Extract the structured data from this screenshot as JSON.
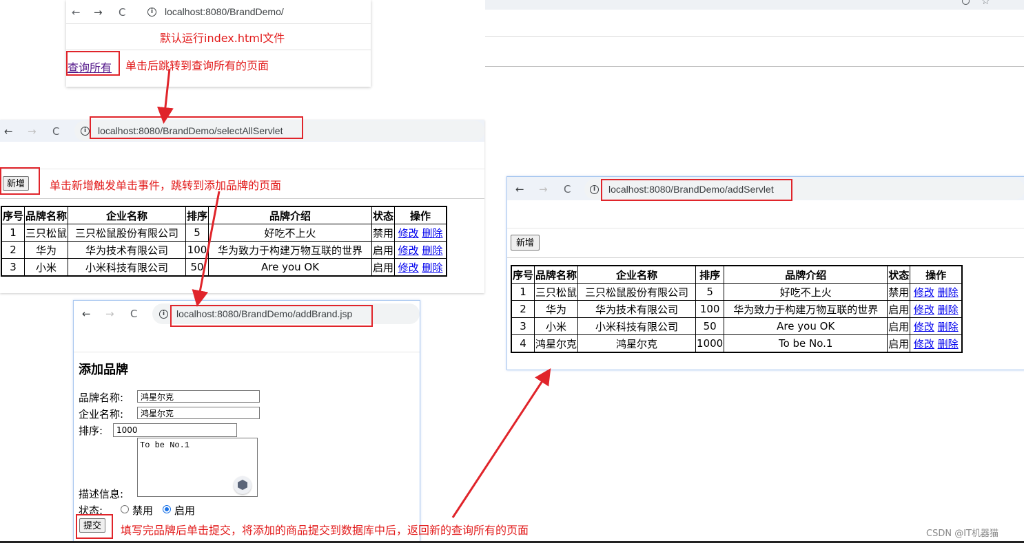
{
  "bg_browser": {
    "search_icon": "magnifier-icon",
    "star_icon": "star-icon"
  },
  "window1": {
    "nav": {
      "back": "←",
      "forward": "→",
      "reload": "C"
    },
    "url": "localhost:8080/BrandDemo/",
    "note_default": "默认运行index.html文件",
    "link_query_all": "查询所有",
    "note_click_link": "单击后跳转到查询所有的页面"
  },
  "window2": {
    "nav": {
      "back": "←",
      "forward": "→",
      "reload": "C"
    },
    "url": "localhost:8080/BrandDemo/selectAllServlet",
    "add_button": "新增",
    "note_add": "单击新增触发单击事件，跳转到添加品牌的页面",
    "table": {
      "headers": [
        "序号",
        "品牌名称",
        "企业名称",
        "排序",
        "品牌介绍",
        "状态",
        "操作"
      ],
      "rows": [
        [
          "1",
          "三只松鼠",
          "三只松鼠股份有限公司",
          "5",
          "好吃不上火",
          "禁用"
        ],
        [
          "2",
          "华为",
          "华为技术有限公司",
          "100",
          "华为致力于构建万物互联的世界",
          "启用"
        ],
        [
          "3",
          "小米",
          "小米科技有限公司",
          "50",
          "Are you OK",
          "启用"
        ]
      ],
      "edit_label": "修改",
      "delete_label": "删除"
    }
  },
  "window3": {
    "nav": {
      "back": "←",
      "forward": "→",
      "reload": "C"
    },
    "url": "localhost:8080/BrandDemo/addBrand.jsp",
    "heading": "添加品牌",
    "form": {
      "brand_label": "品牌名称:",
      "brand_value": "鸿星尔克",
      "company_label": "企业名称:",
      "company_value": "鸿星尔克",
      "ordered_label": "排序:",
      "ordered_value": "1000",
      "desc_label": "描述信息:",
      "desc_value": "To be No.1",
      "status_label": "状态:",
      "status_disabled": "禁用",
      "status_enabled": "启用",
      "status_selected": "启用",
      "submit": "提交"
    },
    "note_submit": "填写完品牌后单击提交，将添加的商品提交到数据库中后，返回新的查询所有的页面"
  },
  "window4": {
    "nav": {
      "back": "←",
      "forward": "→",
      "reload": "C"
    },
    "url": "localhost:8080/BrandDemo/addServlet",
    "add_button": "新增",
    "table": {
      "headers": [
        "序号",
        "品牌名称",
        "企业名称",
        "排序",
        "品牌介绍",
        "状态",
        "操作"
      ],
      "rows": [
        [
          "1",
          "三只松鼠",
          "三只松鼠股份有限公司",
          "5",
          "好吃不上火",
          "禁用"
        ],
        [
          "2",
          "华为",
          "华为技术有限公司",
          "100",
          "华为致力于构建万物互联的世界",
          "启用"
        ],
        [
          "3",
          "小米",
          "小米科技有限公司",
          "50",
          "Are you OK",
          "启用"
        ],
        [
          "4",
          "鸿星尔克",
          "鸿星尔克",
          "1000",
          "To be No.1",
          "启用"
        ]
      ],
      "edit_label": "修改",
      "delete_label": "删除"
    }
  },
  "watermark": "CSDN @IT机器猫",
  "colors": {
    "annotation_red": "#e21b1b",
    "link_blue": "#0000ee",
    "radio_blue": "#1a73e8"
  }
}
